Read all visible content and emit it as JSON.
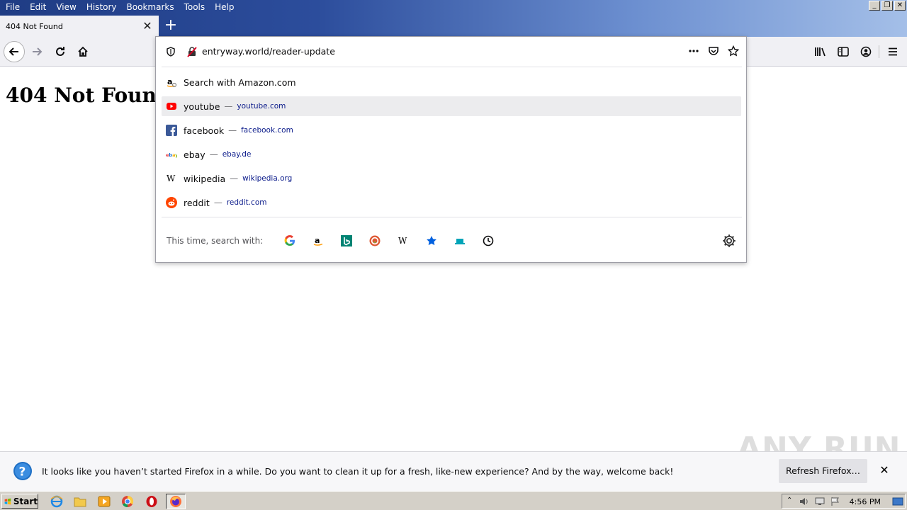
{
  "menu": [
    "File",
    "Edit",
    "View",
    "History",
    "Bookmarks",
    "Tools",
    "Help"
  ],
  "window_buttons": [
    "_",
    "❐",
    "✕"
  ],
  "tab": {
    "title": "404 Not Found"
  },
  "page": {
    "heading": "404 Not Found"
  },
  "urlbar": {
    "url": "entryway.world/reader-update",
    "suggestions": [
      {
        "title": "Search with Amazon.com",
        "url": "",
        "icon": "amazon-icon"
      },
      {
        "title": "youtube",
        "url": "youtube.com",
        "icon": "youtube-icon",
        "selected": true
      },
      {
        "title": "facebook",
        "url": "facebook.com",
        "icon": "facebook-icon"
      },
      {
        "title": "ebay",
        "url": "ebay.de",
        "icon": "ebay-icon"
      },
      {
        "title": "wikipedia",
        "url": "wikipedia.org",
        "icon": "wikipedia-icon"
      },
      {
        "title": "reddit",
        "url": "reddit.com",
        "icon": "reddit-icon"
      }
    ],
    "dash": "—",
    "engines_label": "This time, search with:",
    "engines": [
      "google-icon",
      "amazon-icon",
      "bing-icon",
      "duckduckgo-icon",
      "wikipedia-icon",
      "bookmarks-star-icon",
      "tabs-icon",
      "history-clock-icon"
    ]
  },
  "notification": {
    "text": "It looks like you haven’t started Firefox in a while. Do you want to clean it up for a fresh, like-new experience? And by the way, welcome back!",
    "button": "Refresh Firefox…"
  },
  "watermark": "ANY RUN",
  "taskbar": {
    "start": "Start",
    "time": "4:56 PM"
  },
  "colors": {
    "titlebar": "#2c4d9c",
    "selected_row": "#ececee",
    "url_link": "#0a1a8a"
  }
}
